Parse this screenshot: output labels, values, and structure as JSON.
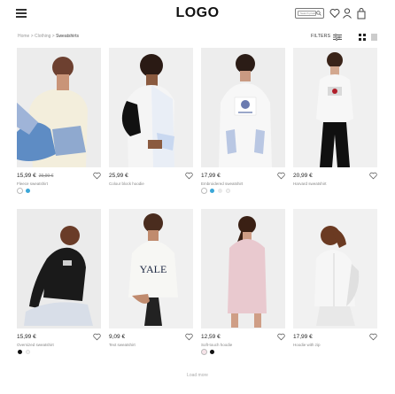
{
  "header": {
    "logo": "LOGO",
    "search_placeholder": "Search products",
    "icons": [
      "menu-icon",
      "search-icon",
      "heart-icon",
      "user-icon",
      "bag-icon"
    ]
  },
  "breadcrumb": [
    "Home",
    "Clothing",
    "Sweatshirts"
  ],
  "toolbar": {
    "filters_label": "FILTERS"
  },
  "colors": {
    "accent": "#3ba7d8",
    "ink": "#222222",
    "muted": "#888888"
  },
  "products": [
    {
      "price": "15,99 €",
      "old_price": "29,99 €",
      "name": "Fleece sweatshirt",
      "swatches": [
        "#ffffff",
        "#3ba7d8"
      ]
    },
    {
      "price": "25,99 €",
      "old_price": "",
      "name": "Colour block hoodie",
      "swatches": []
    },
    {
      "price": "17,99 €",
      "old_price": "",
      "name": "Embroidered sweatshirt",
      "swatches": [
        "#ffffff",
        "#3ba7d8",
        "#e8e8e8",
        "#f4f4f4"
      ]
    },
    {
      "price": "20,99 €",
      "old_price": "",
      "name": "Harvard sweatshirt",
      "swatches": []
    },
    {
      "price": "15,99 €",
      "old_price": "",
      "name": "Oversized sweatshirt",
      "swatches": [
        "#111111",
        "#f4f4f4"
      ]
    },
    {
      "price": "9,09 €",
      "old_price": "",
      "name": "Text sweatshirt",
      "swatches": []
    },
    {
      "price": "12,59 €",
      "old_price": "",
      "name": "Soft-touch hoodie",
      "swatches": [
        "#f6e3e8",
        "#111111"
      ]
    },
    {
      "price": "17,99 €",
      "old_price": "",
      "name": "Hoodie with zip",
      "swatches": []
    }
  ],
  "load_more": "Load more"
}
